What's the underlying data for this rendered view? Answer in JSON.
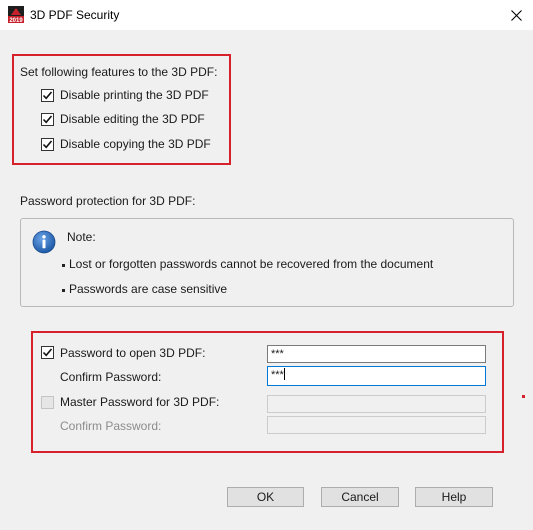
{
  "window": {
    "title": "3D PDF Security",
    "app_icon": "autocad-2019-icon",
    "app_icon_label": "2019",
    "close_icon": "close-icon"
  },
  "features": {
    "heading": "Set following features to the 3D PDF:",
    "items": [
      {
        "label": "Disable printing the 3D PDF",
        "checked": true
      },
      {
        "label": "Disable editing the 3D PDF",
        "checked": true
      },
      {
        "label": "Disable copying the 3D PDF",
        "checked": true
      }
    ]
  },
  "password_section": {
    "heading": "Password protection for 3D PDF:"
  },
  "note": {
    "icon": "info-icon",
    "title": "Note:",
    "bullets": [
      "Lost or forgotten passwords cannot be recovered from the document",
      "Passwords are case sensitive"
    ]
  },
  "passwords": {
    "open": {
      "label": "Password to open 3D PDF:",
      "checked": true,
      "value": "***"
    },
    "open_confirm": {
      "label": "Confirm Password:",
      "value": "***"
    },
    "master": {
      "label": "Master Password for 3D PDF:",
      "checked": false,
      "enabled": false,
      "value": ""
    },
    "master_confirm": {
      "label": "Confirm Password:",
      "enabled": false,
      "value": ""
    }
  },
  "buttons": {
    "ok": "OK",
    "cancel": "Cancel",
    "help": "Help"
  },
  "colors": {
    "highlight": "#d6202c",
    "info_blue": "#2f6fc1",
    "focus": "#0078d7"
  }
}
